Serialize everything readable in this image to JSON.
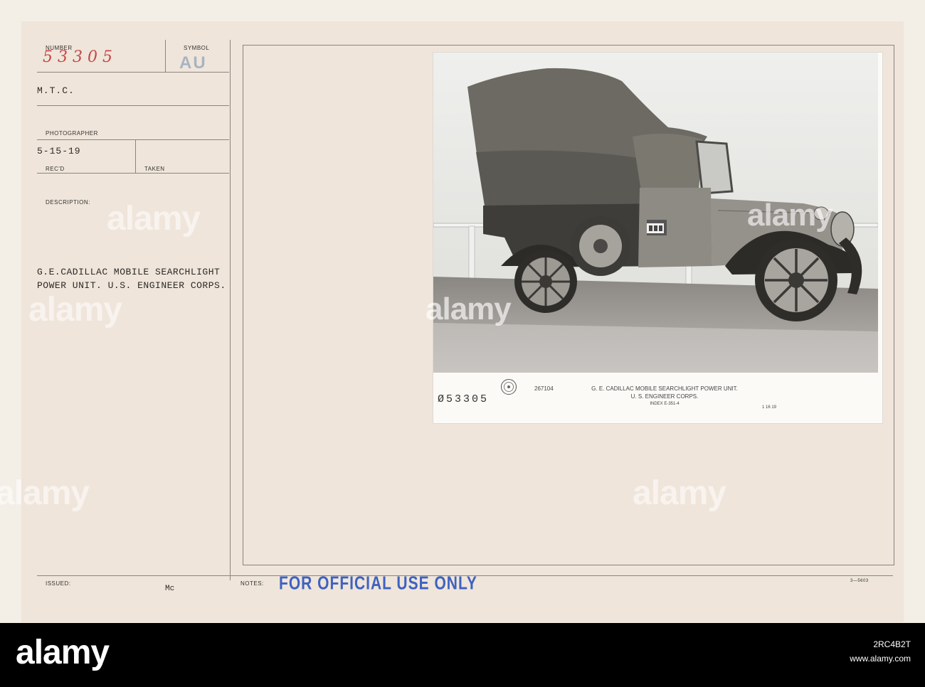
{
  "card": {
    "number_label": "NUMBER",
    "number_value": "53305",
    "symbol_label": "SYMBOL",
    "symbol_value": "AU",
    "unit": "M.T.C.",
    "photographer_label": "PHOTOGRAPHER",
    "date_received": "5-15-19",
    "recd_label": "REC'D",
    "taken_label": "TAKEN",
    "description_label": "DESCRIPTION:",
    "description_line1": "G.E.CADILLAC MOBILE SEARCHLIGHT",
    "description_line2": "POWER UNIT. U.S. ENGINEER CORPS.",
    "issued_label": "ISSUED:",
    "issued_value": "Mc",
    "notes_label": "NOTES:",
    "stamp_text": "FOR OFFICIAL USE ONLY",
    "form_number": "3—5603"
  },
  "photo": {
    "negative_number": "Ø53305",
    "print_number": "267104",
    "caption_line1": "G. E. CADILLAC MOBILE SEARCHLIGHT POWER UNIT.",
    "caption_line2": "U. S. ENGINEER CORPS.",
    "caption_index": "INDEX E-351-4",
    "caption_date": "1 16 19",
    "seal_icon": "seal-icon"
  },
  "watermark": {
    "text": "alamy",
    "footer_id": "2RC4B2T",
    "footer_text": "www.alamy.com"
  },
  "colors": {
    "card": "#efe5da",
    "red_ink": "#c64848",
    "blue_stamp": "#3e62c0",
    "footer": "#000000"
  }
}
